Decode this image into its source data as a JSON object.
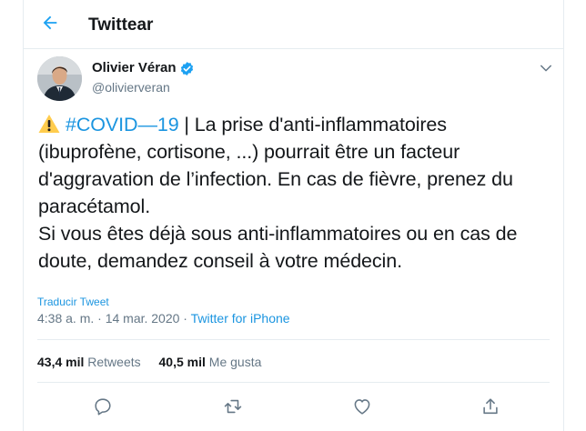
{
  "header": {
    "title": "Twittear",
    "back_icon": "arrow-left-icon"
  },
  "author": {
    "name": "Olivier Véran",
    "handle": "@olivierveran",
    "verified_icon": "verified-badge-icon"
  },
  "tweet": {
    "warning_icon": "warning-icon",
    "hashtag": "#COVID—19",
    "line1_rest": " | La prise d'anti-inflammatoires",
    "line2": "(ibuprofène, cortisone, ...) pourrait être un facteur",
    "line3": "d'aggravation de l’infection. En cas de fièvre, prenez du",
    "line4": "paracétamol.",
    "line5": "Si vous êtes déjà sous anti-inflammatoires ou en cas de",
    "line6": "doute, demandez conseil à votre médecin."
  },
  "translate_label": "Traducir Tweet",
  "meta": {
    "timestamp": "4:38 a. m. · 14 mar. 2020",
    "separator": " · ",
    "source": "Twitter for iPhone"
  },
  "stats": {
    "retweets_count": "43,4 mil",
    "retweets_label": "Retweets",
    "likes_count": "40,5 mil",
    "likes_label": "Me gusta"
  },
  "actions": [
    "reply-icon",
    "retweet-icon",
    "like-icon",
    "share-icon"
  ],
  "colors": {
    "accent": "#1b95e0",
    "text": "#14171a",
    "muted": "#657786",
    "border": "#e6ecf0",
    "verified": "#1da1f2"
  }
}
